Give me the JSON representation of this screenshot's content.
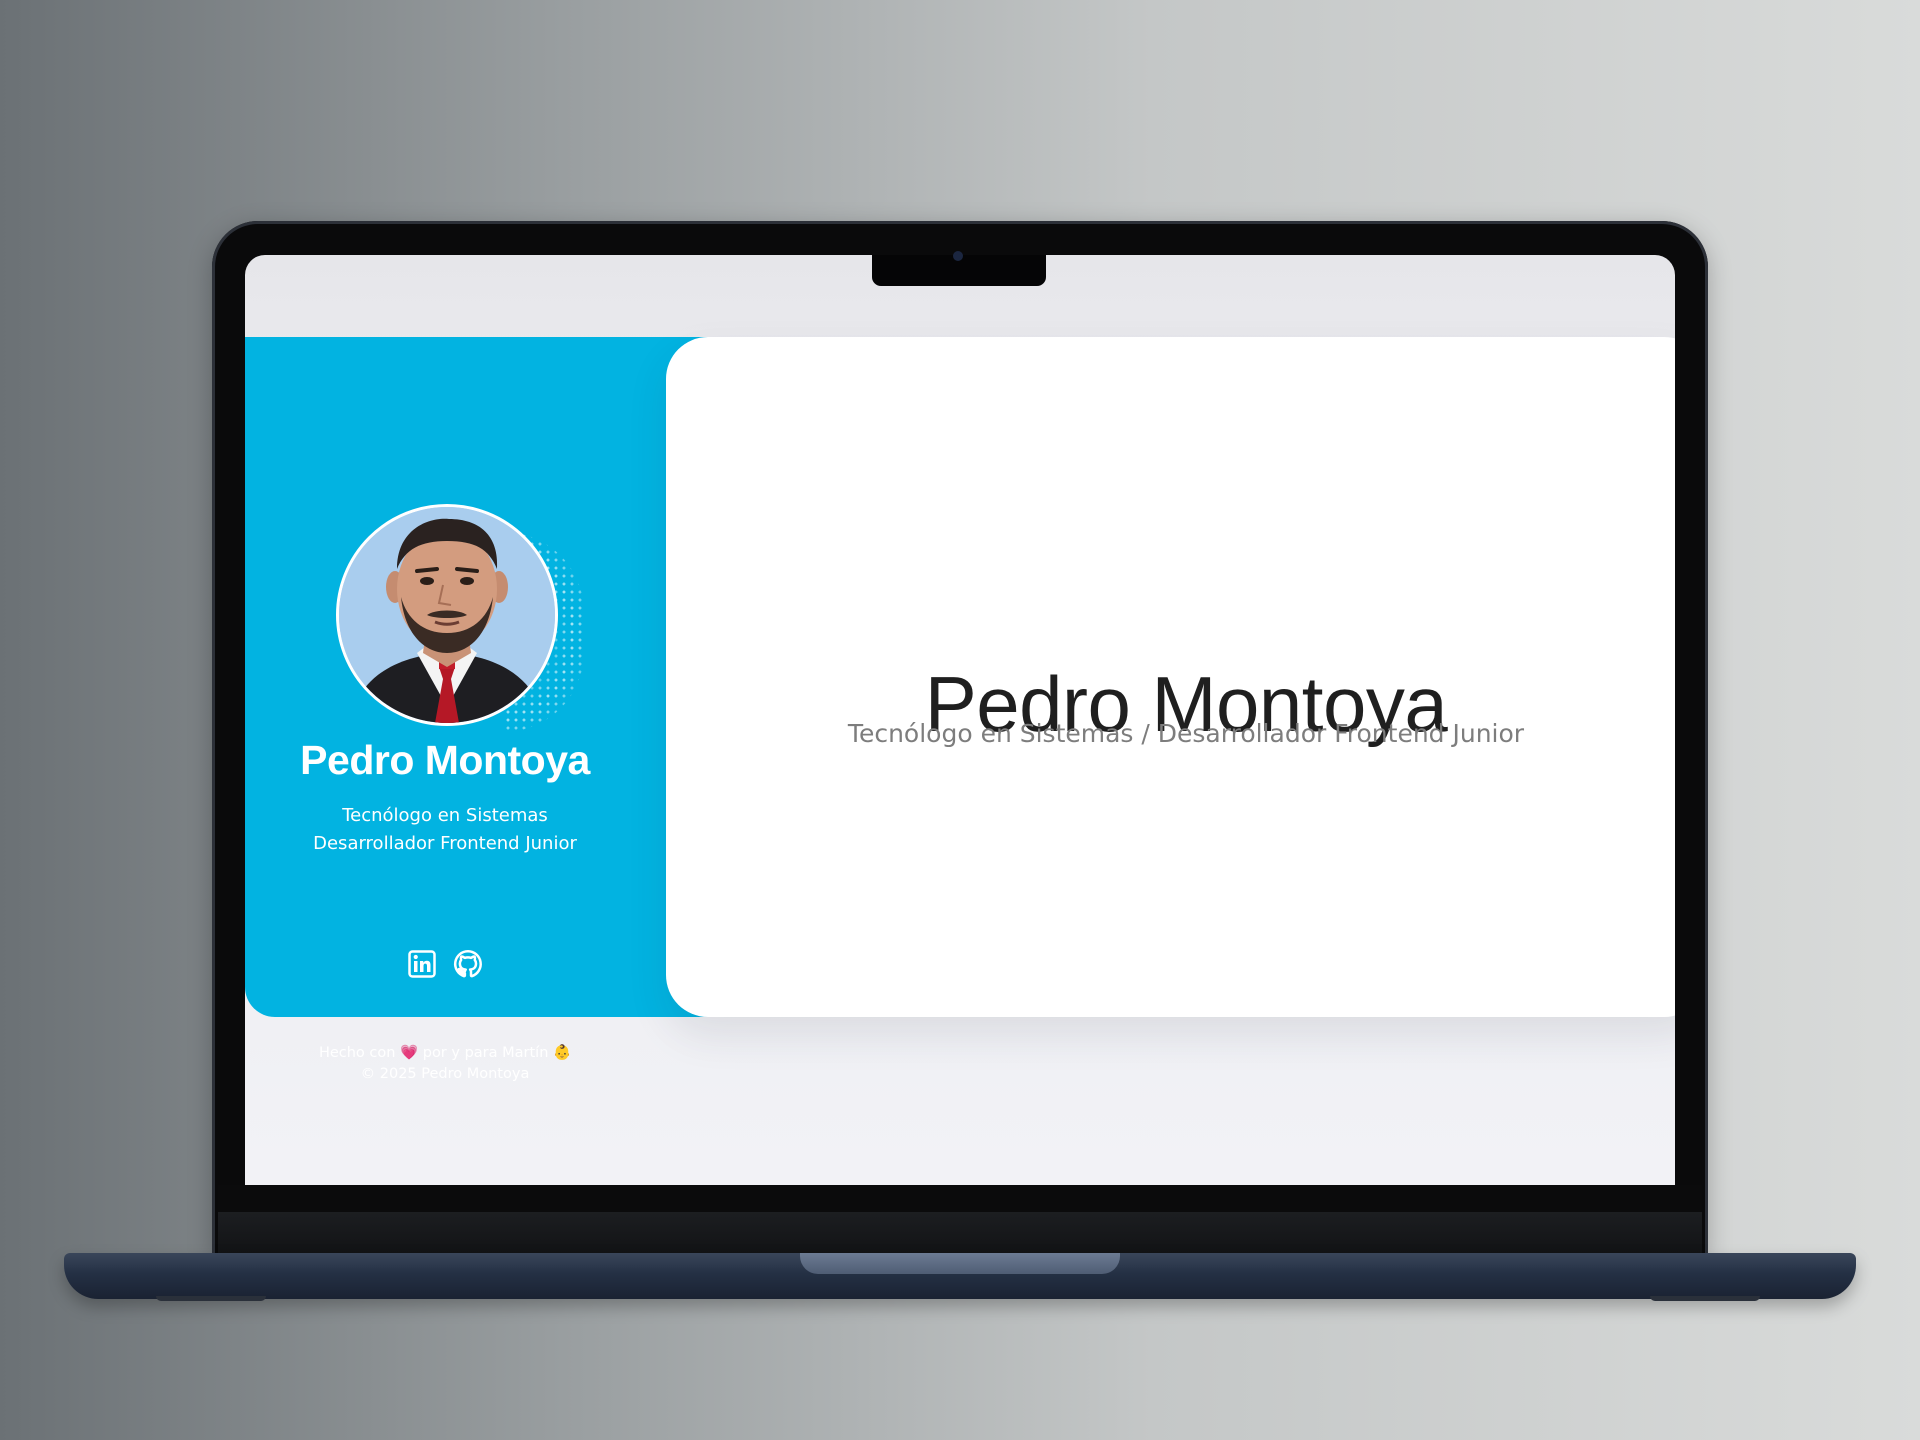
{
  "profile": {
    "name": "Pedro Montoya",
    "role_line_1": "Tecnólogo en Sistemas",
    "role_line_2": "Desarrollador Frontend Junior"
  },
  "social": {
    "items": [
      {
        "icon": "linkedin-icon"
      },
      {
        "icon": "github-icon"
      }
    ]
  },
  "footer": {
    "made_with_prefix": "Hecho con",
    "heart": "💗",
    "made_with_suffix": "por y para Martín",
    "baby": "👶",
    "copyright": "© 2025 Pedro Montoya"
  },
  "main": {
    "title": "Pedro Montoya",
    "subtitle": "Tecnólogo en Sistemas / Desarrollador Frontend Junior"
  },
  "colors": {
    "sidebar_bg": "#02b3e1",
    "card_bg": "#ffffff",
    "title_text": "#1f1f1f",
    "subtitle_text": "#7d7d7d"
  }
}
